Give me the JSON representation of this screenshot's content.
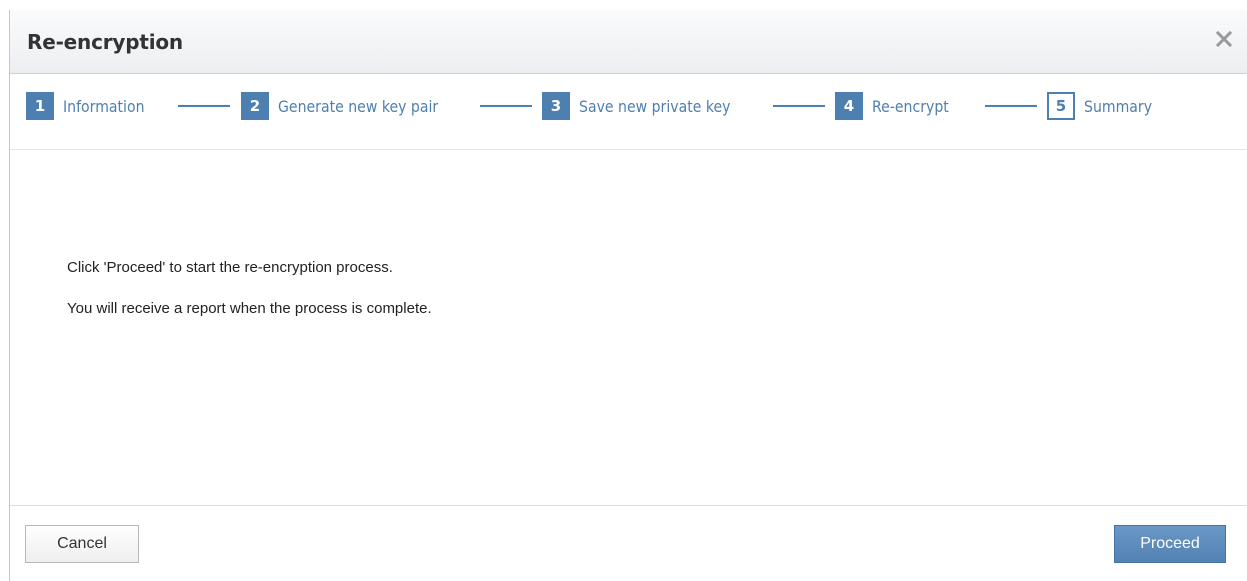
{
  "dialog": {
    "title": "Re-encryption",
    "close_icon": "close-icon"
  },
  "steps": [
    {
      "number": "1",
      "label": "Information",
      "state": "completed"
    },
    {
      "number": "2",
      "label": "Generate new key pair",
      "state": "completed"
    },
    {
      "number": "3",
      "label": "Save new private key",
      "state": "completed"
    },
    {
      "number": "4",
      "label": "Re-encrypt",
      "state": "completed"
    },
    {
      "number": "5",
      "label": "Summary",
      "state": "current"
    }
  ],
  "content": {
    "line1": "Click 'Proceed' to start the re-encryption process.",
    "line2": "You will receive a report when the process is complete."
  },
  "footer": {
    "cancel_label": "Cancel",
    "proceed_label": "Proceed"
  },
  "colors": {
    "accent": "#4d7fb0",
    "proceed_button": "#5a8abb"
  }
}
